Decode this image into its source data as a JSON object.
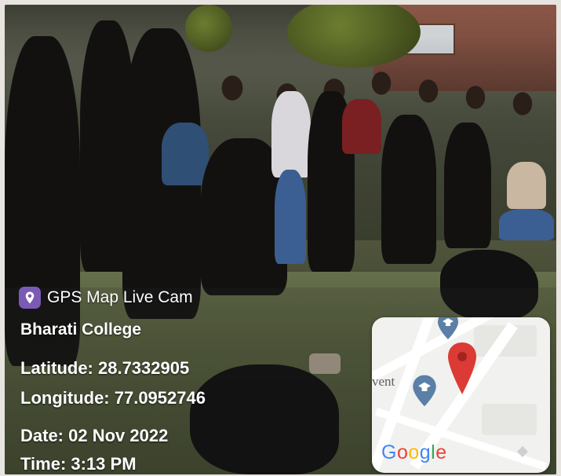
{
  "overlay": {
    "app_name": "GPS Map Live Cam",
    "app_icon": "location-pin-icon",
    "place": "Bharati College",
    "latitude": "Latitude: 28.7332905",
    "longitude": "Longitude: 77.0952746",
    "date": "Date: 02 Nov 2022",
    "time": "Time: 3:13 PM"
  },
  "map": {
    "label_partial": "vent",
    "logo_letters": [
      "G",
      "o",
      "o",
      "g",
      "l",
      "e"
    ],
    "logo_colors": [
      "#4285F4",
      "#EA4335",
      "#FBBC05",
      "#4285F4",
      "#34A853",
      "#EA4335"
    ],
    "pin_color": "#DB3B34",
    "school_pin_color": "#5B7FA6",
    "icons": [
      "red-map-pin-icon",
      "school-pin-icon"
    ]
  },
  "colors": {
    "badge_purple": "#7B5AB6",
    "text_white": "#FFFFFF"
  }
}
